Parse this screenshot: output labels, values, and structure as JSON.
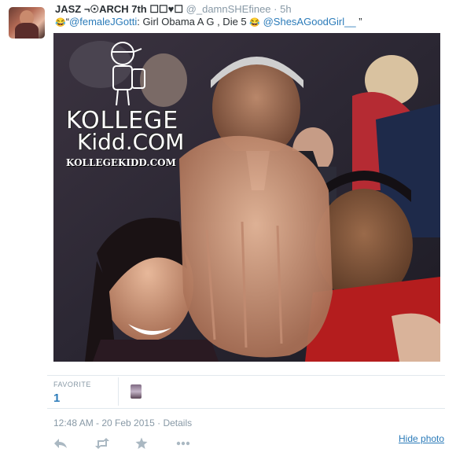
{
  "tweet": {
    "display_name": "JASZ ¬☉ARCH 7th ☐☐♥☐",
    "screen_name": "@_damnSHEfinee",
    "separator": "·",
    "relative_time": "5h",
    "text_emoji_start": "😂",
    "text_quote_open": "“",
    "text_mention_1": "@femaleJGotti",
    "text_body": ": Girl Obama A G , Die 5 ",
    "text_emoji_mid": "😂",
    "text_mention_2": "@ShesAGoodGirl__",
    "text_quote_close": " ”"
  },
  "photo": {
    "watermark_line1": "KOLLEGE",
    "watermark_line2": "Kidd.COM",
    "watermark_url": "KOLLEGEKIDD.COM"
  },
  "stats": {
    "favorite_label": "FAVORITE",
    "favorite_count": "1"
  },
  "meta": {
    "timestamp": "12:48 AM - 20 Feb 2015",
    "separator": "·",
    "details_label": "Details"
  },
  "actions": {
    "reply_icon": "reply-icon",
    "retweet_icon": "retweet-icon",
    "favorite_icon": "star-icon",
    "more_icon": "more-icon",
    "hide_photo_label": "Hide photo"
  },
  "colors": {
    "link": "#2b7bb9",
    "muted": "#8899a6",
    "divider": "#e1e8ed"
  }
}
